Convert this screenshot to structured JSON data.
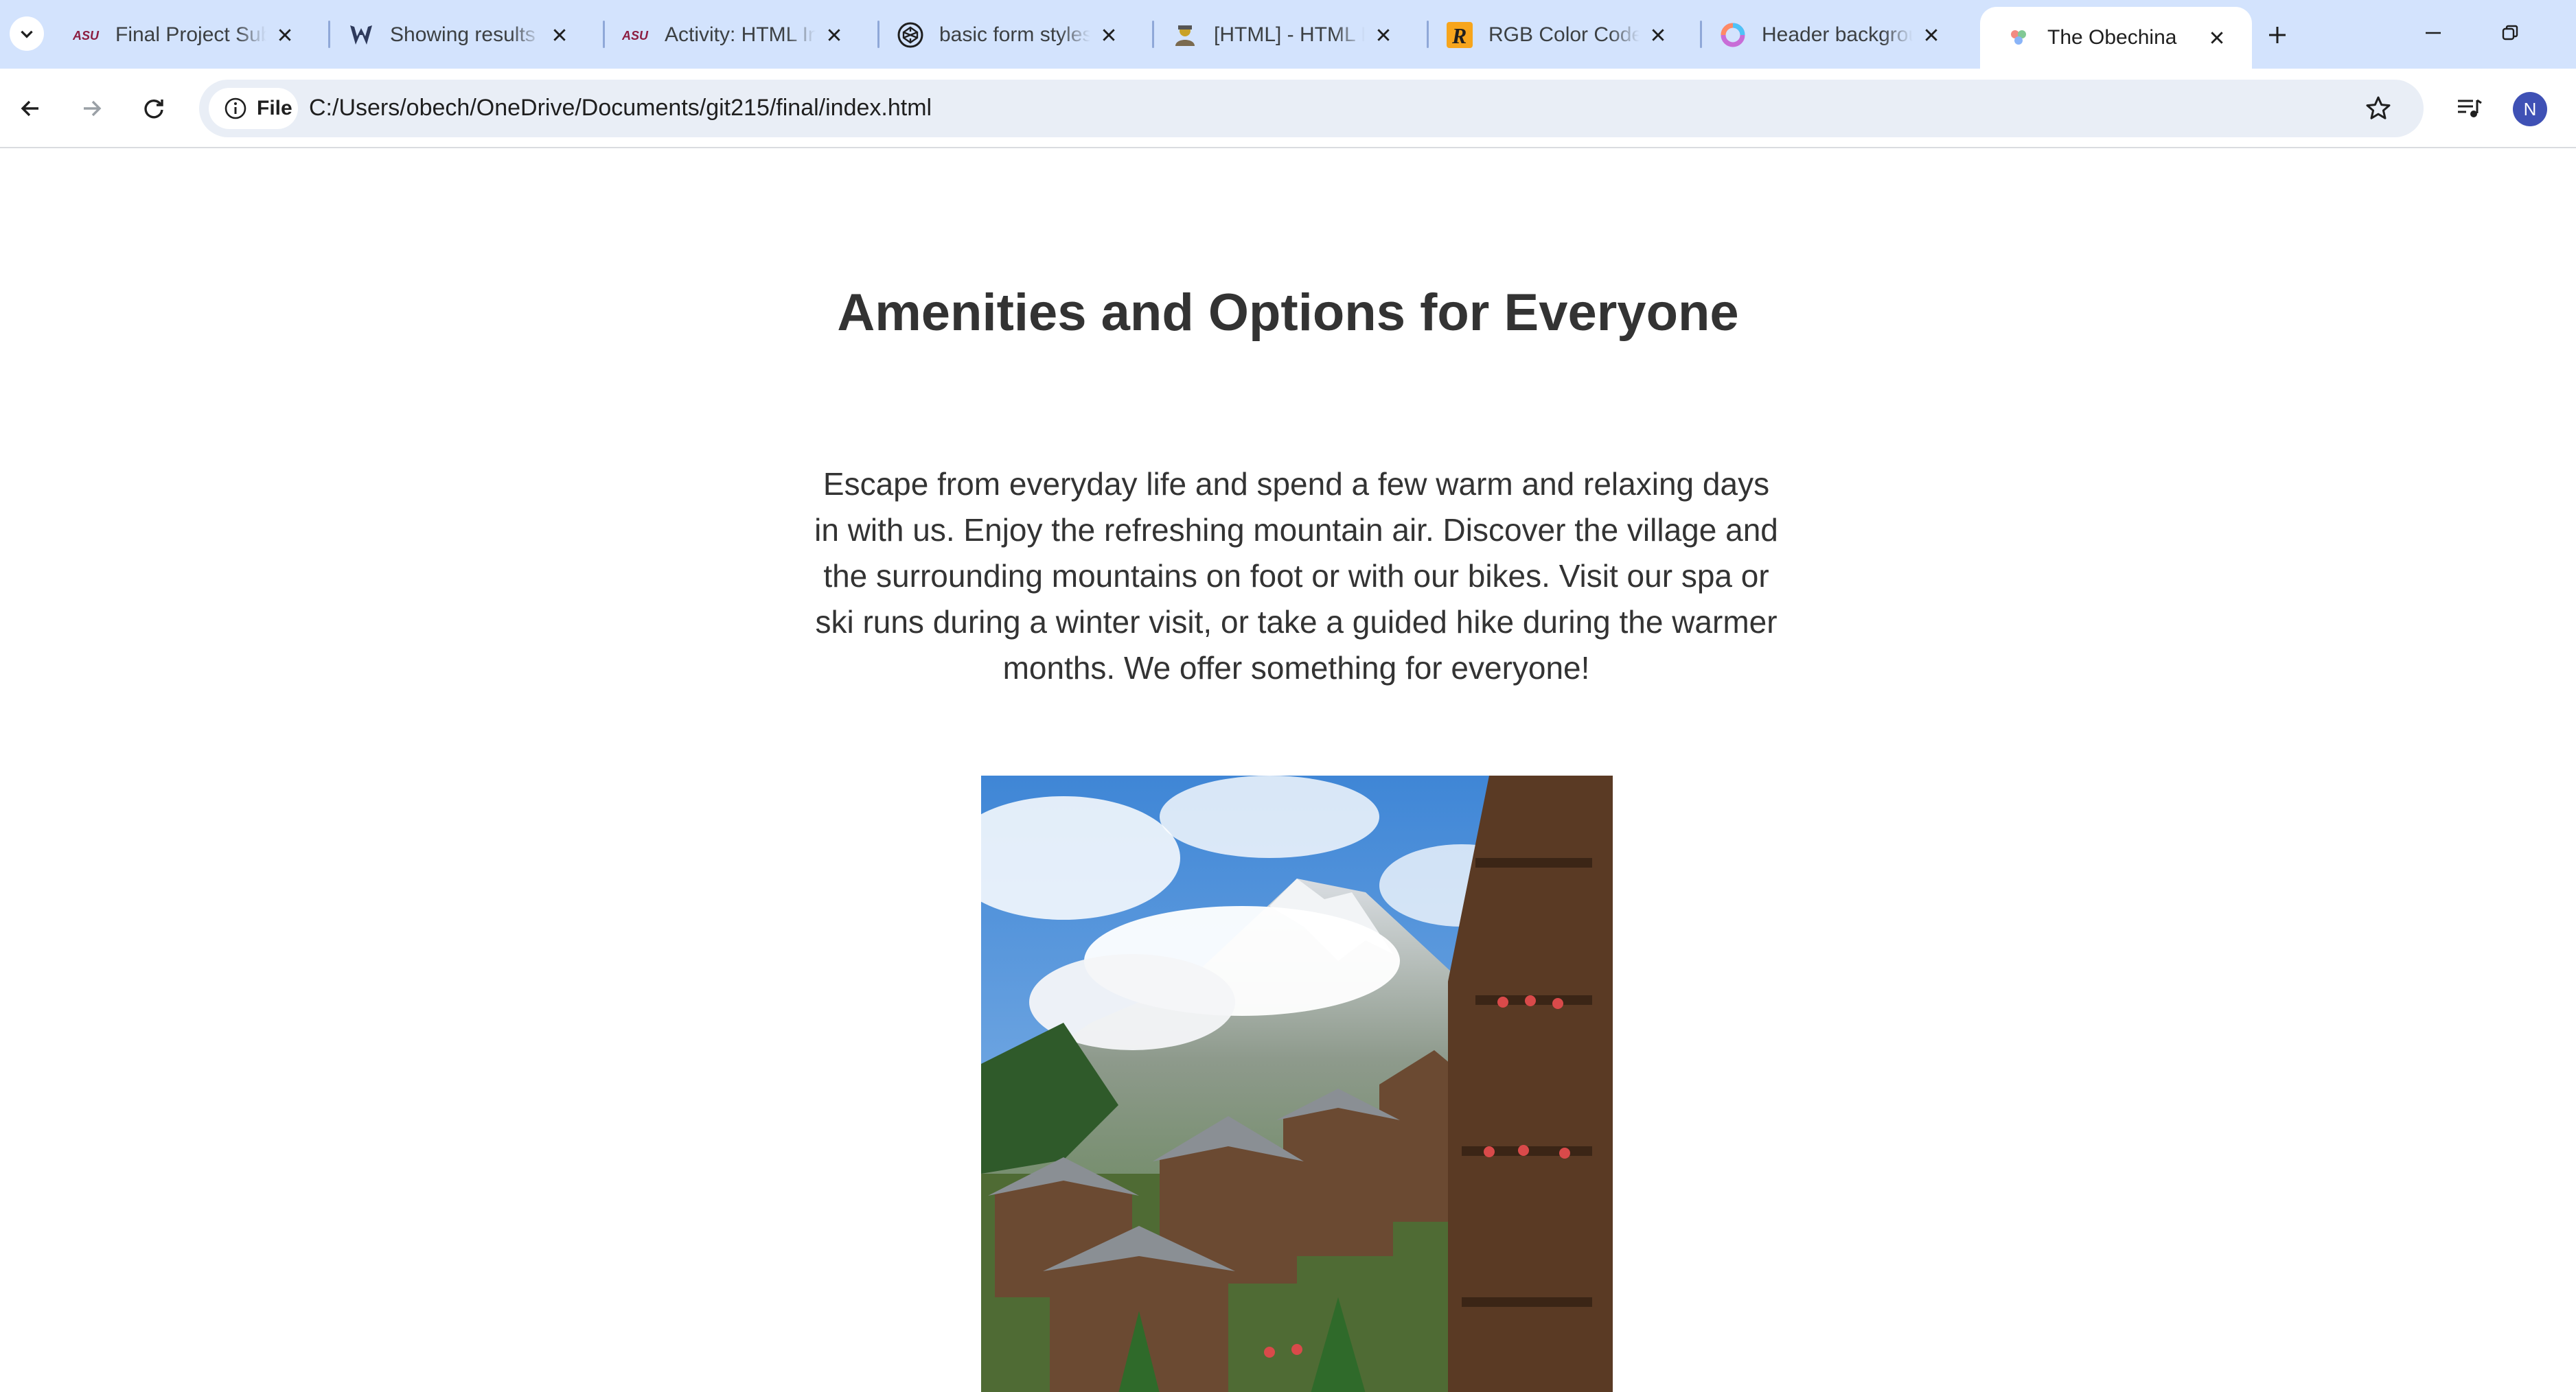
{
  "browser": {
    "tabs": [
      {
        "title": "Final Project Submission",
        "favicon": "asu-icon",
        "active": false
      },
      {
        "title": "Showing results for",
        "favicon": "wolverine-icon",
        "active": false
      },
      {
        "title": "Activity: HTML Intro",
        "favicon": "asu-icon",
        "active": false
      },
      {
        "title": "basic form styles",
        "favicon": "codepen-icon",
        "active": false
      },
      {
        "title": "[HTML] - HTML Inputs",
        "favicon": "user-icon",
        "active": false
      },
      {
        "title": "RGB Color Codes",
        "favicon": "r-logo-icon",
        "active": false
      },
      {
        "title": "Header background",
        "favicon": "gradient-ring-icon",
        "active": false
      },
      {
        "title": "The Obechina",
        "favicon": "colorful-dots-icon",
        "active": true
      }
    ],
    "address_bar": {
      "security_chip": "File",
      "url": "C:/Users/obech/OneDrive/Documents/git215/final/index.html"
    },
    "profile_initial": "N"
  },
  "page": {
    "heading": "Amenities and Options for Everyone",
    "intro": "Escape from everyday life and spend a few warm and relaxing days in with us. Enjoy the refreshing mountain air. Discover the village and the surrounding mountains on foot or with our bikes. Visit our spa or ski runs during a winter visit, or take a guided hike during the warmer months. We offer something for everyone!",
    "image": "mountain-village-photo"
  }
}
